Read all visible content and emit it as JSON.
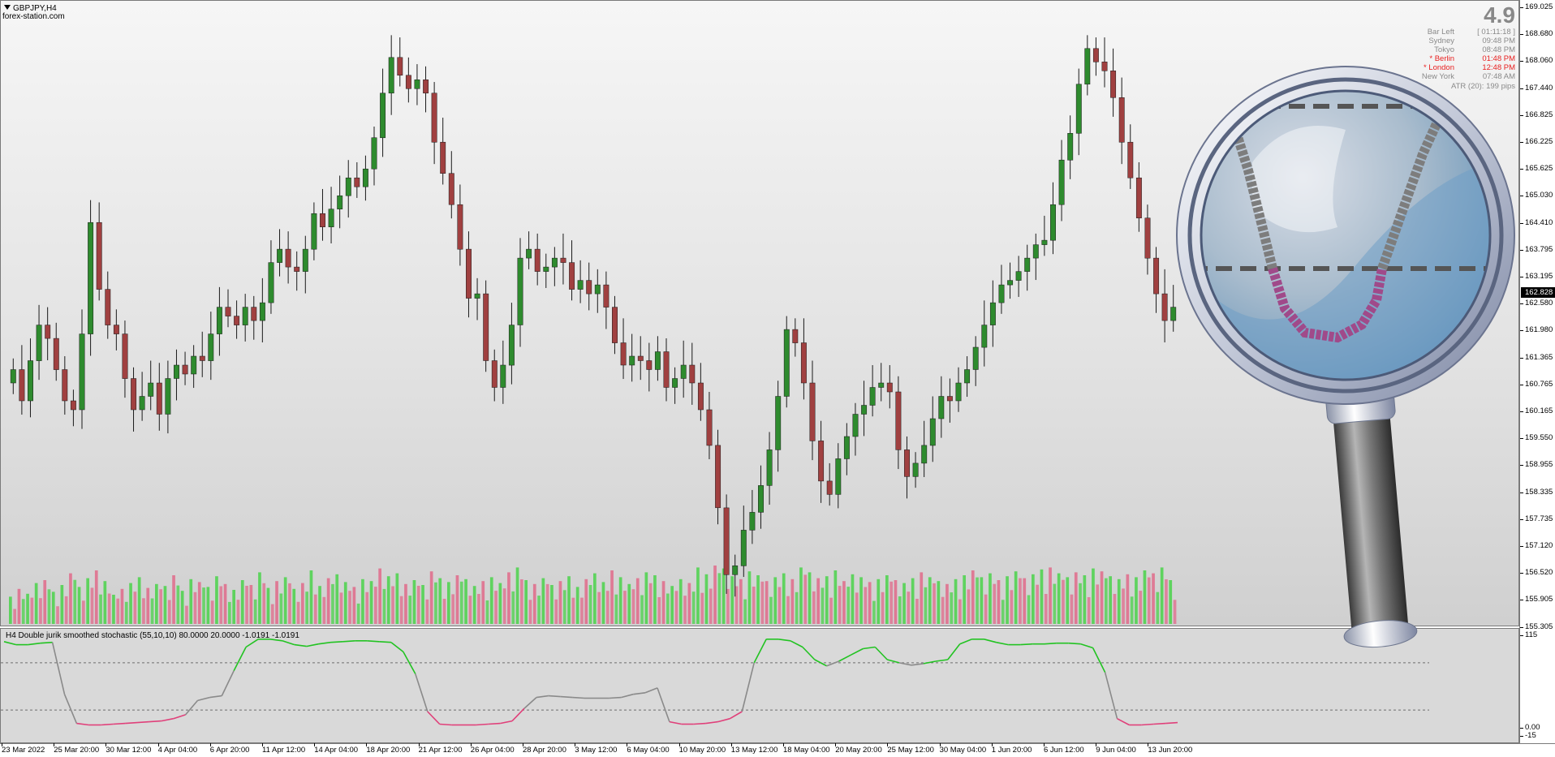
{
  "window": {
    "symbol": "GBPJPY,H4",
    "site": "forex-station.com"
  },
  "info_panel": {
    "spread": "4.9",
    "rows": [
      {
        "label": "Bar Left",
        "value": "[ 01:11:18 ]",
        "highlight": false
      },
      {
        "label": "Sydney",
        "value": "09:48 PM",
        "highlight": false
      },
      {
        "label": "Tokyo",
        "value": "08:48 PM",
        "highlight": false
      },
      {
        "label": "* Berlin",
        "value": "01:48 PM",
        "highlight": true
      },
      {
        "label": "* London",
        "value": "12:48 PM",
        "highlight": true
      },
      {
        "label": "New York",
        "value": "07:48 AM",
        "highlight": false
      }
    ],
    "atr": "ATR (20): 199 pips"
  },
  "indicator": {
    "title": "H4 Double jurik smoothed stochastic (55,10,10) 80.0000 20.0000 -1.0191 -1.0191",
    "scale_labels": [
      "115",
      "0.00",
      "-15"
    ]
  },
  "price_scale": {
    "ticks": [
      "169.025",
      "168.680",
      "168.060",
      "167.440",
      "166.825",
      "166.225",
      "165.625",
      "165.030",
      "164.410",
      "163.795",
      "163.195",
      "162.580",
      "161.980",
      "161.365",
      "160.765",
      "160.165",
      "159.550",
      "158.955",
      "158.335",
      "157.735",
      "157.120",
      "156.520",
      "155.905",
      "155.305"
    ],
    "current_price": "162.828"
  },
  "time_scale": {
    "ticks": [
      "23 Mar 2022",
      "25 Mar 20:00",
      "30 Mar 12:00",
      "4 Apr 04:00",
      "6 Apr 20:00",
      "11 Apr 12:00",
      "14 Apr 04:00",
      "18 Apr 20:00",
      "21 Apr 12:00",
      "26 Apr 04:00",
      "28 Apr 20:00",
      "3 May 12:00",
      "6 May 04:00",
      "10 May 20:00",
      "13 May 12:00",
      "18 May 04:00",
      "20 May 20:00",
      "25 May 12:00",
      "30 May 04:00",
      "1 Jun 20:00",
      "6 Jun 12:00",
      "9 Jun 04:00",
      "13 Jun 20:00"
    ]
  },
  "colors": {
    "bull": "#2e8b2e",
    "bear": "#a04040",
    "wick": "#1a1a1a",
    "vol_up": "#4ad24a",
    "vol_down": "#e06a8a",
    "stoch_up": "#22c322",
    "stoch_mid": "#8a8a8a",
    "stoch_down": "#e0407a"
  },
  "chart_data": {
    "type": "candlestick",
    "ylim": [
      155.305,
      169.025
    ],
    "closes": [
      160.9,
      160.2,
      161.1,
      161.9,
      161.6,
      160.9,
      160.2,
      160.0,
      161.7,
      164.2,
      162.7,
      161.9,
      161.7,
      160.7,
      160.0,
      160.3,
      160.6,
      159.9,
      160.7,
      161.0,
      160.8,
      161.2,
      161.1,
      161.7,
      162.3,
      162.1,
      161.9,
      162.3,
      162.0,
      162.4,
      163.3,
      163.6,
      163.2,
      163.1,
      163.6,
      164.4,
      164.1,
      164.5,
      164.8,
      165.2,
      165.0,
      165.4,
      166.1,
      167.1,
      167.9,
      167.5,
      167.2,
      167.4,
      167.1,
      166.0,
      165.3,
      164.6,
      163.6,
      162.5,
      162.6,
      161.1,
      160.5,
      161.0,
      161.9,
      163.4,
      163.6,
      163.1,
      163.2,
      163.4,
      163.3,
      162.7,
      162.9,
      162.6,
      162.8,
      162.3,
      161.5,
      161.0,
      161.2,
      161.1,
      160.9,
      161.3,
      160.5,
      160.7,
      161.0,
      160.6,
      160.0,
      159.2,
      157.8,
      156.3,
      156.5,
      157.3,
      157.7,
      158.3,
      159.1,
      160.3,
      161.8,
      161.5,
      160.6,
      159.3,
      158.4,
      158.1,
      158.9,
      159.4,
      159.9,
      160.1,
      160.5,
      160.6,
      160.4,
      159.1,
      158.5,
      158.8,
      159.2,
      159.8,
      160.3,
      160.2,
      160.6,
      160.9,
      161.4,
      161.9,
      162.4,
      162.8,
      162.9,
      163.1,
      163.4,
      163.7,
      163.8,
      164.6,
      165.6,
      166.2,
      167.3,
      168.1,
      167.8,
      167.6,
      167.0,
      166.0,
      165.2,
      164.3,
      163.4,
      162.6,
      162.0,
      162.3
    ]
  },
  "volume_data": [
    28,
    36,
    31,
    42,
    45,
    33,
    40,
    52,
    38,
    47,
    55,
    44,
    30,
    36,
    42,
    48,
    37,
    41,
    39,
    50,
    34,
    46,
    43,
    38,
    49,
    41,
    35,
    45,
    40,
    53,
    37,
    44,
    48,
    36,
    42,
    55,
    39,
    47,
    51,
    43,
    38,
    46,
    44,
    57,
    49,
    52,
    41,
    45,
    40,
    54,
    47,
    43,
    50,
    46,
    39,
    44,
    48,
    42,
    53,
    58,
    45,
    41,
    47,
    40,
    44,
    49,
    38,
    46,
    52,
    43,
    55,
    48,
    41,
    47,
    53,
    50,
    44,
    39,
    46,
    42,
    58,
    51,
    60,
    57,
    49,
    46,
    54,
    50,
    44,
    48,
    52,
    46,
    58,
    53,
    47,
    49,
    55,
    44,
    51,
    48,
    43,
    46,
    50,
    45,
    42,
    47,
    53,
    48,
    44,
    41,
    46,
    50,
    55,
    48,
    52,
    45,
    49,
    54,
    47,
    51,
    56,
    58,
    52,
    48,
    53,
    50,
    57,
    54,
    49,
    46,
    51,
    48,
    55,
    52,
    58,
    45
  ],
  "stochastic_data": [
    107,
    103,
    103,
    105,
    106,
    40,
    3,
    1,
    1,
    2,
    3,
    4,
    5,
    6,
    9,
    14,
    32,
    36,
    38,
    70,
    100,
    110,
    110,
    108,
    103,
    101,
    104,
    106,
    107,
    108,
    108,
    107,
    106,
    94,
    66,
    18,
    2,
    1,
    1,
    1,
    2,
    3,
    6,
    22,
    36,
    38,
    37,
    36,
    35,
    35,
    35,
    36,
    40,
    42,
    48,
    5,
    2,
    2,
    3,
    5,
    9,
    18,
    80,
    110,
    110,
    108,
    100,
    84,
    76,
    82,
    90,
    98,
    100,
    84,
    80,
    77,
    79,
    82,
    84,
    104,
    110,
    110,
    106,
    103,
    103,
    104,
    104,
    105,
    105,
    104,
    99,
    68,
    9,
    1,
    1,
    2,
    3,
    4
  ]
}
